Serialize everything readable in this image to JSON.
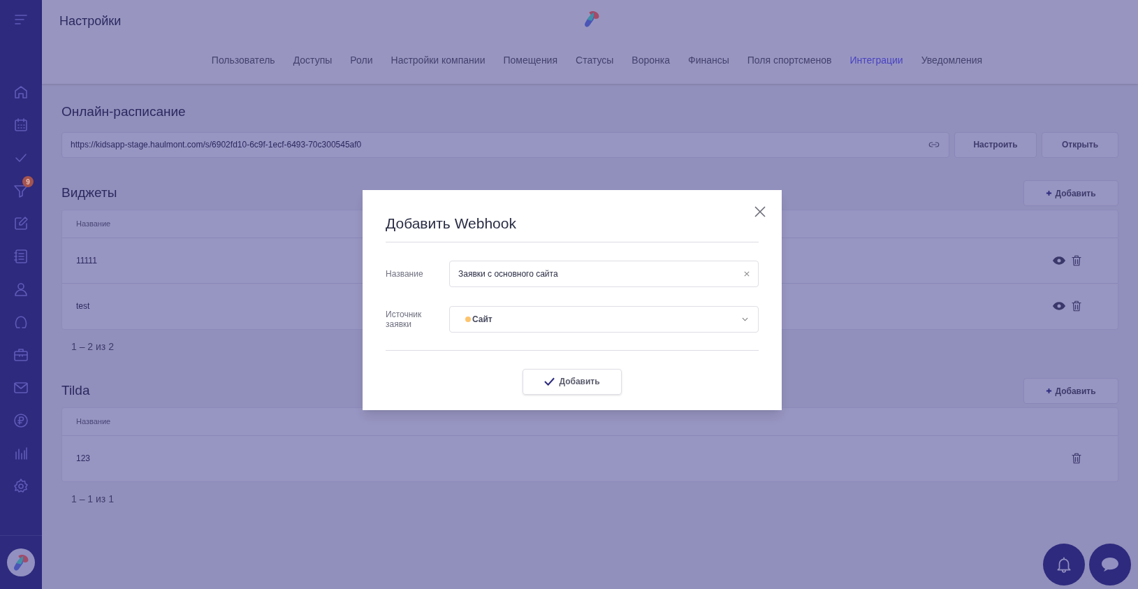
{
  "header": {
    "title": "Настройки"
  },
  "sidebar": {
    "filter_badge": "9"
  },
  "tabs": [
    {
      "label": "Пользователь",
      "selected": false
    },
    {
      "label": "Доступы",
      "selected": false
    },
    {
      "label": "Роли",
      "selected": false
    },
    {
      "label": "Настройки компании",
      "selected": false
    },
    {
      "label": "Помещения",
      "selected": false
    },
    {
      "label": "Статусы",
      "selected": false
    },
    {
      "label": "Воронка",
      "selected": false
    },
    {
      "label": "Финансы",
      "selected": false
    },
    {
      "label": "Поля спортсменов",
      "selected": false
    },
    {
      "label": "Интеграции",
      "selected": true
    },
    {
      "label": "Уведомления",
      "selected": false
    }
  ],
  "online_schedule": {
    "title": "Онлайн-расписание",
    "url": "https://kidsapp-stage.haulmont.com/s/6902fd10-6c9f-1ecf-6493-70c300545af0",
    "buttons": [
      "Настроить",
      "Открыть"
    ]
  },
  "sections": [
    {
      "title": "Виджеты",
      "add_button": "Добавить",
      "column": "Название",
      "rows": [
        {
          "name": "11111",
          "viewable": true
        },
        {
          "name": "test",
          "viewable": true
        }
      ],
      "pager": "1 – 2 из 2"
    },
    {
      "title": "Tilda",
      "add_button": "Добавить",
      "column": "Название",
      "rows": [
        {
          "name": "123",
          "viewable": false
        }
      ],
      "pager": "1 – 1 из 1"
    }
  ],
  "modal": {
    "title": "Добавить Webhook",
    "fields": [
      {
        "kind": "text",
        "label": "Название",
        "value": "Заявки с основного сайта"
      },
      {
        "kind": "select",
        "label": "Источник заявки",
        "value": "Сайт",
        "color": "#fdc46e"
      }
    ],
    "submit": "Добавить"
  }
}
